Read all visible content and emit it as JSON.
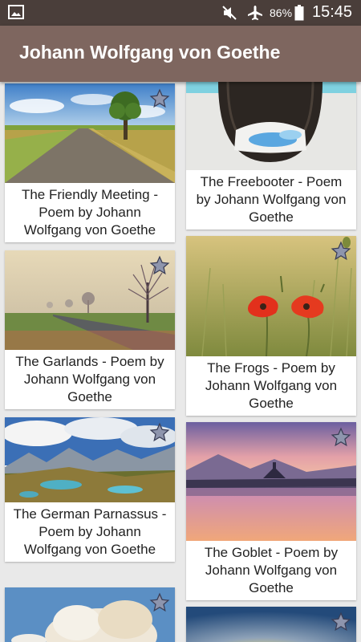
{
  "status_bar": {
    "battery_percent": "86%",
    "time": "15:45"
  },
  "app_bar": {
    "title": "Johann Wolfgang von Goethe"
  },
  "poems": [
    {
      "title": "The Friendly Meeting - Poem by Johann Wolfgang von Goethe",
      "image": "country-road"
    },
    {
      "title": "The Freebooter - Poem by Johann Wolfgang von Goethe",
      "image": "wicker-chair"
    },
    {
      "title": "The Garlands - Poem by Johann Wolfgang von Goethe",
      "image": "foggy-trees"
    },
    {
      "title": "The Frogs - Poem by Johann Wolfgang von Goethe",
      "image": "poppies"
    },
    {
      "title": "The German Parnassus - Poem by Johann Wolfgang von Goethe",
      "image": "mountain-lakes"
    },
    {
      "title": "The Goblet - Poem by Johann Wolfgang von Goethe",
      "image": "lake-sunset"
    },
    {
      "title": "",
      "image": "clouds-tree"
    },
    {
      "title": "",
      "image": "sunset-sky"
    }
  ]
}
